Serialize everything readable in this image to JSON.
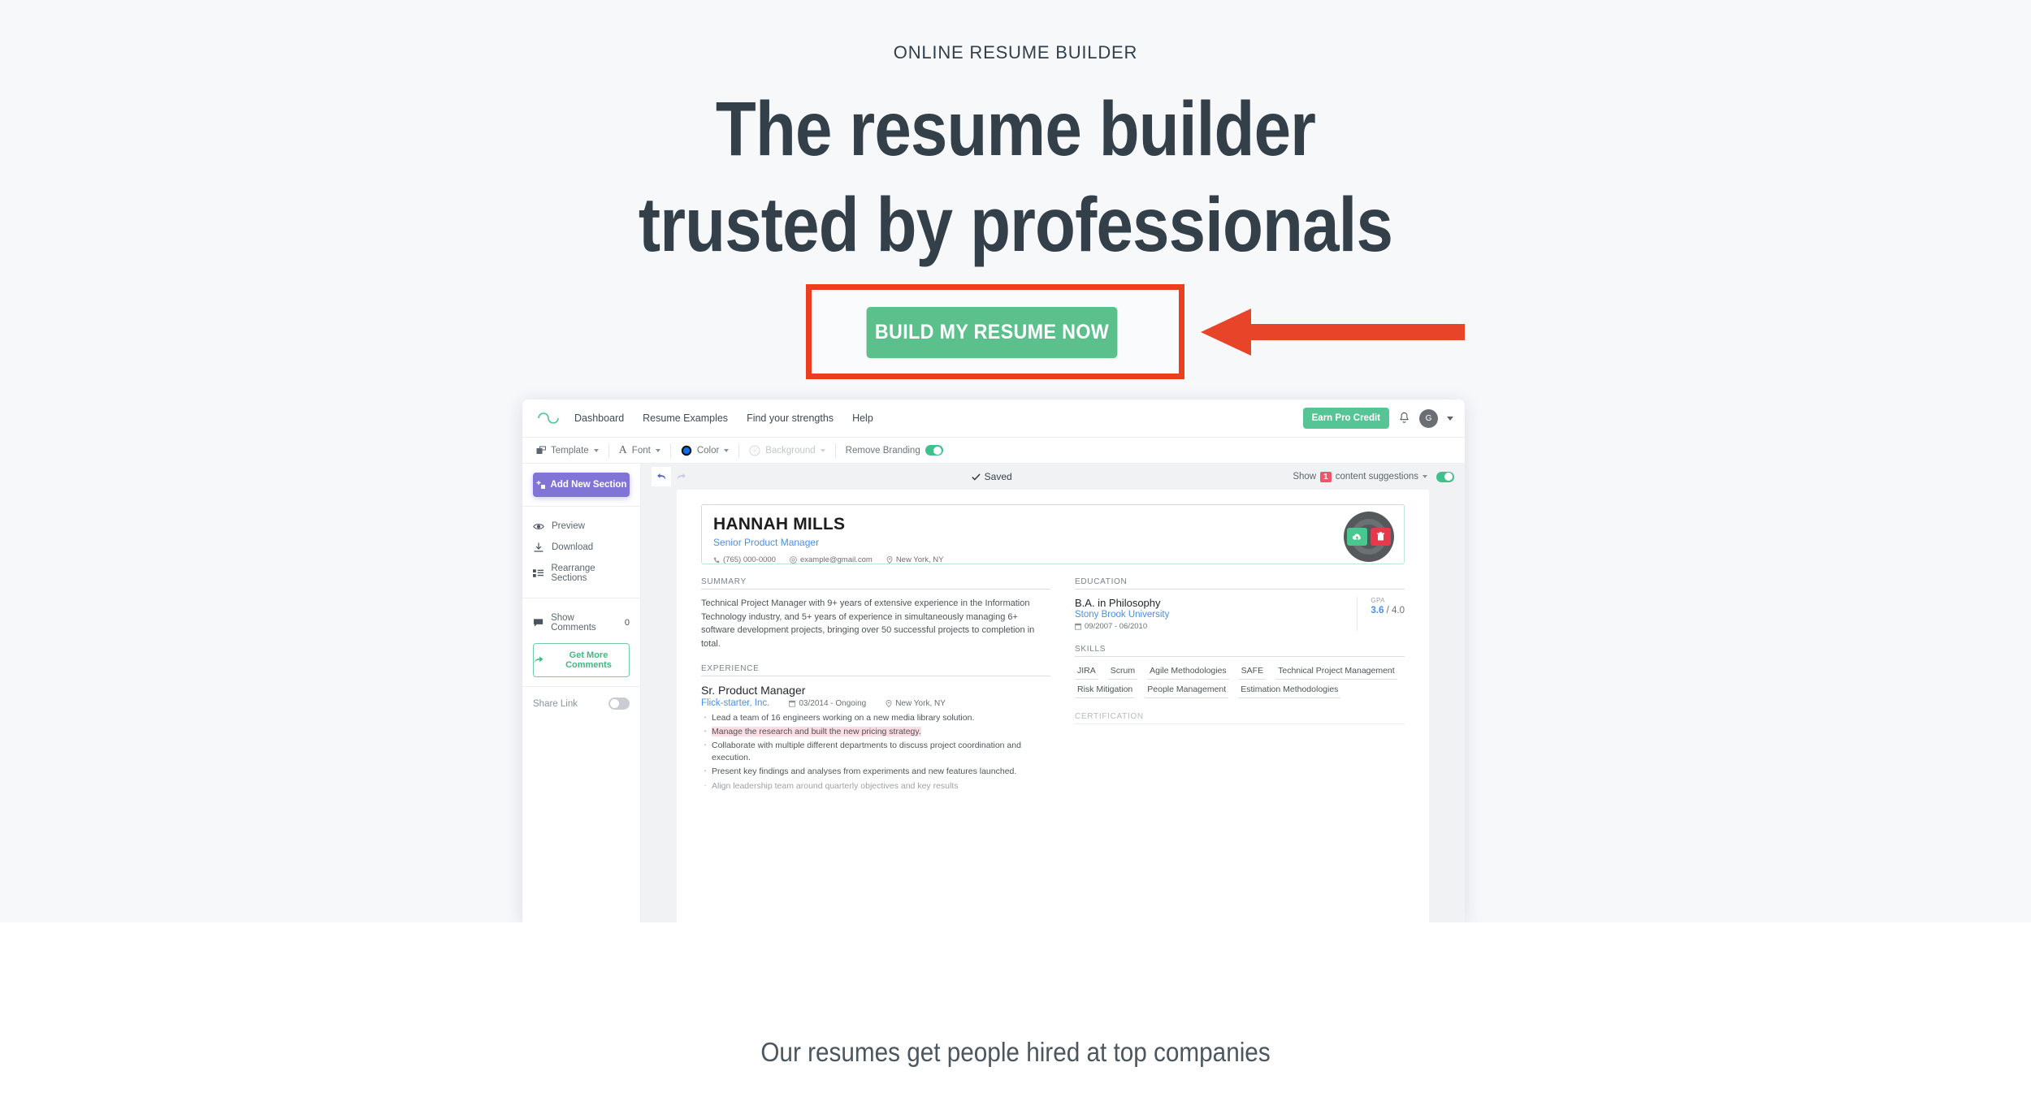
{
  "hero": {
    "eyebrow": "ONLINE RESUME BUILDER",
    "headline_line1": "The resume builder",
    "headline_line2": "trusted by professionals",
    "cta_label": "BUILD MY RESUME NOW",
    "annotation_color": "#ec3e1e",
    "cta_color": "#5cc08d",
    "background": "#f7f8fa"
  },
  "bottom": {
    "tagline": "Our resumes get people hired at top companies"
  },
  "app": {
    "navbar": {
      "logo": "infinity-logo",
      "links": [
        {
          "label": "Dashboard"
        },
        {
          "label": "Resume Examples"
        },
        {
          "label": "Find your strengths"
        },
        {
          "label": "Help"
        }
      ],
      "pro_button": "Earn Pro Credit",
      "notifications_icon": "bell-icon",
      "avatar_initial": "G"
    },
    "toolbar": {
      "template": "Template",
      "font": "Font",
      "color": "Color",
      "color_swatch": "#0b6df0",
      "background": "Background",
      "remove_branding": "Remove Branding",
      "remove_branding_on": true
    },
    "sidebar": {
      "add_section": "Add New Section",
      "items": [
        {
          "label": "Preview",
          "icon": "eye-icon"
        },
        {
          "label": "Download",
          "icon": "download-icon"
        },
        {
          "label": "Rearrange Sections",
          "icon": "rearrange-icon"
        }
      ],
      "show_comments": "Show Comments",
      "comments_count": "0",
      "get_more_comments": "Get More Comments",
      "share_link": "Share Link",
      "share_link_on": false
    },
    "editor_bar": {
      "saved": "Saved",
      "suggestions_prefix": "Show",
      "suggestions_count": "1",
      "suggestions_suffix": "content suggestions",
      "suggestions_on": true
    },
    "resume": {
      "name": "HANNAH MILLS",
      "title": "Senior Product Manager",
      "phone": "(765) 000-0000",
      "email": "example@gmail.com",
      "location": "New York, NY",
      "summary_label": "SUMMARY",
      "summary": "Technical Project Manager with 9+ years of extensive experience in the Information Technology industry, and 5+ years of experience in simultaneously managing 6+ software development projects, bringing over 50 successful projects to completion in total.",
      "experience_label": "EXPERIENCE",
      "job_title": "Sr. Product Manager",
      "job_company": "Flick-starter, Inc.",
      "job_dates": "03/2014 - Ongoing",
      "job_location": "New York, NY",
      "bullets": [
        "Lead a team of 16 engineers working on a new media library solution.",
        "Manage the research and built the new pricing strategy.",
        "Collaborate with multiple different departments to discuss project coordination and execution.",
        "Present key findings and analyses from experiments and new features launched."
      ],
      "bullet_cut": "Align leadership team around quarterly objectives and key results",
      "highlighted_bullet_index": 1,
      "education_label": "EDUCATION",
      "degree": "B.A. in Philosophy",
      "school": "Stony Brook University",
      "edu_dates": "09/2007 - 06/2010",
      "gpa_label": "GPA",
      "gpa_value": "3.6",
      "gpa_scale": "/ 4.0",
      "skills_label": "SKILLS",
      "skills": [
        "JIRA",
        "Scrum",
        "Agile Methodologies",
        "SAFE",
        "Technical Project Management",
        "Risk Mitigation",
        "People Management",
        "Estimation Methodologies"
      ],
      "certification_label": "CERTIFICATION"
    }
  }
}
